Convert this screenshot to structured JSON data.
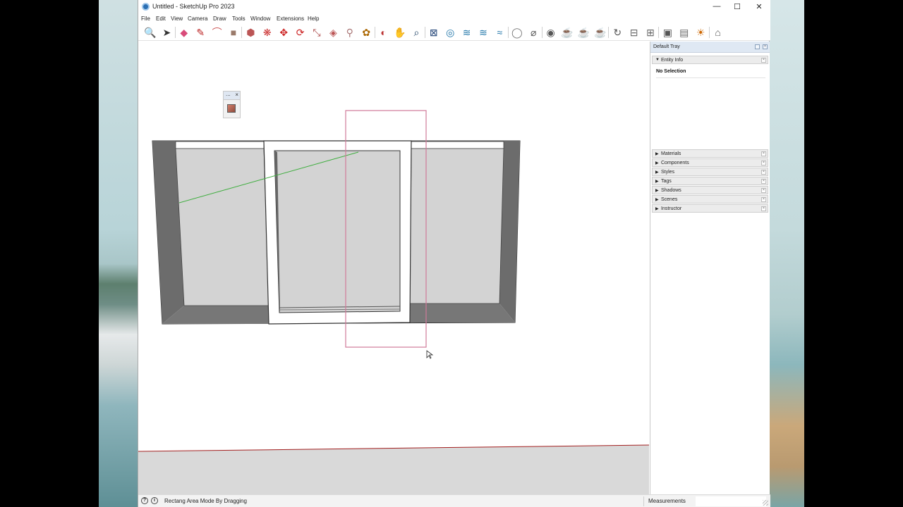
{
  "window": {
    "title": "Untitled - SketchUp Pro 2023",
    "controls": {
      "minimize": "—",
      "maximize": "☐",
      "close": "✕"
    }
  },
  "menu": {
    "items": [
      "File",
      "Edit",
      "View",
      "Camera",
      "Draw",
      "Tools",
      "Window",
      "Extensions",
      "Help"
    ]
  },
  "toolbar": {
    "tools": [
      {
        "name": "zoom-extents",
        "glyph": "🔍"
      },
      {
        "name": "select",
        "glyph": "➤"
      },
      {
        "name": "eraser",
        "glyph": "◆"
      },
      {
        "name": "line",
        "glyph": "✎"
      },
      {
        "name": "arc",
        "glyph": "⌒"
      },
      {
        "name": "rectangle",
        "glyph": "■"
      },
      {
        "name": "push-pull",
        "glyph": "⬢"
      },
      {
        "name": "follow-me",
        "glyph": "❋"
      },
      {
        "name": "move",
        "glyph": "✥"
      },
      {
        "name": "rotate",
        "glyph": "⟳"
      },
      {
        "name": "scale",
        "glyph": "⤡"
      },
      {
        "name": "offset",
        "glyph": "◈"
      },
      {
        "name": "tape-measure",
        "glyph": "⚲"
      },
      {
        "name": "paint-bucket",
        "glyph": "✿"
      },
      {
        "name": "orbit",
        "glyph": "◐"
      },
      {
        "name": "pan",
        "glyph": "✋"
      },
      {
        "name": "zoom",
        "glyph": "⌕"
      },
      {
        "name": "zoom-window",
        "glyph": "⊠"
      },
      {
        "name": "section-plane",
        "glyph": "◎"
      },
      {
        "name": "layers",
        "glyph": "≋"
      },
      {
        "name": "tags",
        "glyph": "≋"
      },
      {
        "name": "styles",
        "glyph": "≈"
      },
      {
        "name": "user",
        "glyph": "◯"
      },
      {
        "name": "extension-warehouse",
        "glyph": "⌀"
      },
      {
        "name": "3d-warehouse",
        "glyph": "◉"
      },
      {
        "name": "teapot-1",
        "glyph": "☕"
      },
      {
        "name": "teapot-2",
        "glyph": "☕"
      },
      {
        "name": "teapot-3",
        "glyph": "☕"
      },
      {
        "name": "refresh",
        "glyph": "↻"
      },
      {
        "name": "sandbox-1",
        "glyph": "⊟"
      },
      {
        "name": "sandbox-2",
        "glyph": "⊞"
      },
      {
        "name": "frame-1",
        "glyph": "▣"
      },
      {
        "name": "frame-2",
        "glyph": "▤"
      },
      {
        "name": "sun",
        "glyph": "☀"
      },
      {
        "name": "hat",
        "glyph": "⌂"
      }
    ]
  },
  "mini_toolbar": {
    "dots": "...",
    "close": "×"
  },
  "tray": {
    "title": "Default Tray",
    "entity_info": {
      "label": "Entity Info",
      "selection": "No Selection"
    },
    "panels": [
      "Materials",
      "Components",
      "Styles",
      "Tags",
      "Shadows",
      "Scenes",
      "Instructor"
    ],
    "arrow_collapsed": "▶",
    "arrow_expanded": "▼",
    "close_glyph": "×"
  },
  "status": {
    "message": "Rectang Area Mode By Dragging",
    "icon1": "?",
    "icon2": "i",
    "measurements_label": "Measurements"
  },
  "colors": {
    "ground": "#d9d9d9",
    "wall_dark": "#6c6c6c",
    "pane": "#d3d3d3",
    "selection_rect": "#d07a9a",
    "green_axis": "#3fae3f",
    "red_axis": "#a32020"
  }
}
